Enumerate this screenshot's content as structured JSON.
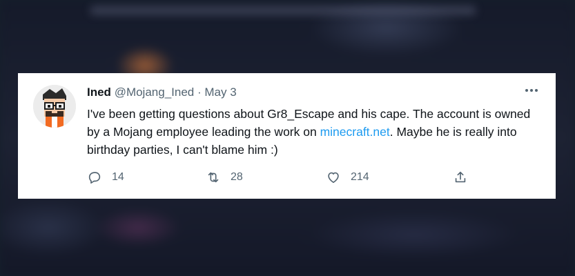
{
  "tweet": {
    "display_name": "Ined",
    "handle": "@Mojang_Ined",
    "separator": "·",
    "date": "May 3",
    "text_part1": "I've been getting questions about Gr8_Escape and his cape. The account is owned by a Mojang employee leading the work on ",
    "link_text": "minecraft.net",
    "text_part2": ". Maybe he is really into birthday parties, I can't blame him :)",
    "more_icon": "more-horizontal-icon",
    "replies": "14",
    "retweets": "28",
    "likes": "214"
  },
  "colors": {
    "link": "#1d9bf0",
    "secondary_text": "#536471",
    "primary_text": "#0f1419",
    "card_bg": "#ffffff"
  }
}
